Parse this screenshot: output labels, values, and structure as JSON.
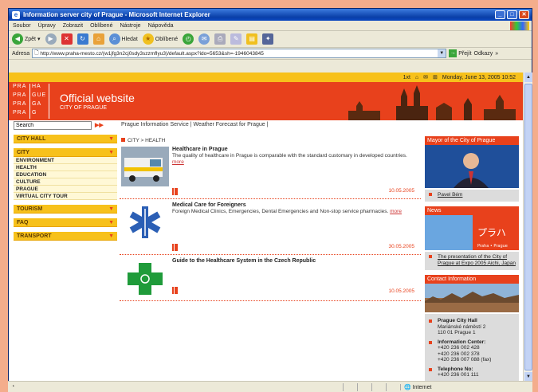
{
  "window": {
    "title": "Information server city of Prague - Microsoft Internet Explorer"
  },
  "menu": [
    "Soubor",
    "Úpravy",
    "Zobrazit",
    "Oblíbené",
    "Nástroje",
    "Nápověda"
  ],
  "toolbar": {
    "back": "Zpět",
    "search": "Hledat",
    "favorites": "Oblíbené"
  },
  "address": {
    "label": "Adresa",
    "url": "http://www.praha-mesto.cz/(w1jfg3n2cj0sdy3szzmflyu3)/default.aspx?ido=5653&sh=-1946043845",
    "go": "Přejít",
    "links": "Odkazy"
  },
  "topstrip": {
    "txt": "1xt",
    "date": "Monday, June 13, 2005 10:52"
  },
  "banner": {
    "logo": [
      "PRA",
      "HA",
      "PRA",
      "GUE",
      "PRA",
      "GA",
      "PRA",
      "G"
    ],
    "title": "Official website",
    "subtitle": "CITY OF PRAGUE"
  },
  "search": {
    "value": "Search"
  },
  "nav": {
    "links": "Prague Information Service  |  Weather Forecast for Prague  |"
  },
  "crumb": {
    "text": "CITY > HEALTH"
  },
  "leftmenu": {
    "cityhall": "CITY HALL",
    "city": "CITY",
    "sub": [
      "ENVIRONMENT",
      "HEALTH",
      "EDUCATION",
      "CULTURE",
      "PRAGUE",
      "VIRTUAL CITY TOUR"
    ],
    "tourism": "TOURISM",
    "faq": "FAQ",
    "transport": "TRANSPORT"
  },
  "articles": [
    {
      "title": "Healthcare in Prague",
      "desc": "The quality of healthcare in Prague is comparable with the standard customary in developed countries.",
      "more": "more",
      "date": "10.05.2005"
    },
    {
      "title": "Medical Care for Foreigners",
      "desc": "Foreign Medical Clinics, Emergencies, Dental Emergencies and Non-stop service pharmacies.",
      "more": "more",
      "date": "30.05.2005"
    },
    {
      "title": "Guide to the Healthcare System in the Czech Republic",
      "desc": "",
      "more": "",
      "date": "10.05.2005"
    }
  ],
  "right": {
    "mayor_head": "Mayor of the City of Prague",
    "mayor_name": "Pavel Bém",
    "news_head": "News",
    "news_img": "プラハ",
    "news_img_sub": "Praha • Prague",
    "news_link": "The presentation of the City of Prague at Expo 2005 Aichi, Japan",
    "contact_head": "Contact Information",
    "c1_title": "Prague City Hall",
    "c1_l1": "Mariánské náměstí 2",
    "c1_l2": "110 01 Prague 1",
    "c2_title": "Information Center:",
    "c2_l1": "+420 236 002 428",
    "c2_l2": "+420 236 002 378",
    "c2_l3": "+420 236 007 088 (fax)",
    "c3_title": "Telephone No:",
    "c3_l1": "+420 236 001 111"
  },
  "status": {
    "zone": "Internet"
  }
}
